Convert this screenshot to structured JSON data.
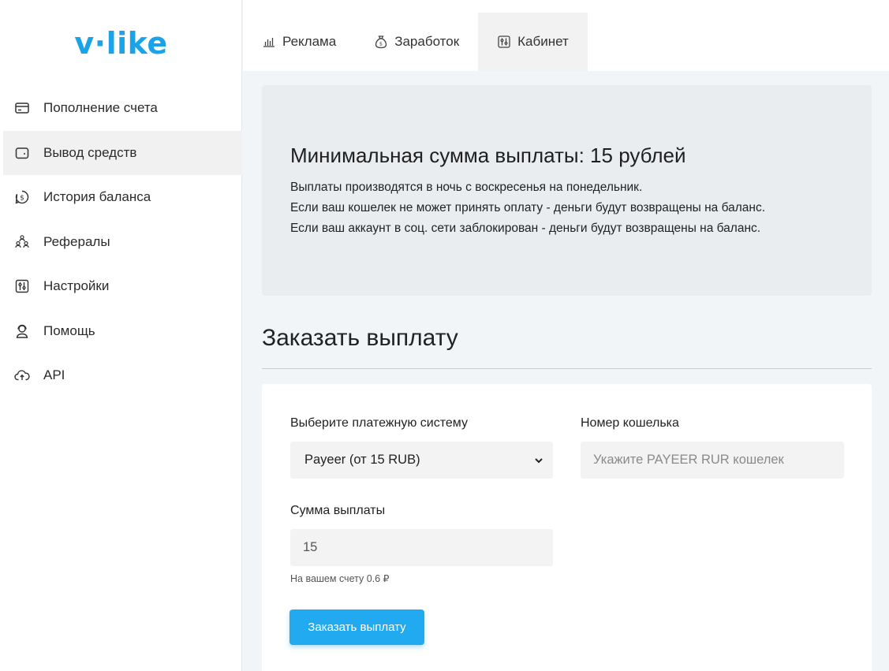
{
  "brand": {
    "logo_text": "v·like",
    "accent_color": "#1aa3e8"
  },
  "sidebar": {
    "items": [
      {
        "label": "Пополнение счета",
        "icon": "credit-card-icon",
        "active": false
      },
      {
        "label": "Вывод средств",
        "icon": "wallet-icon",
        "active": true
      },
      {
        "label": "История баланса",
        "icon": "dollar-coin-icon",
        "active": false
      },
      {
        "label": "Рефералы",
        "icon": "people-group-icon",
        "active": false
      },
      {
        "label": "Настройки",
        "icon": "sliders-icon",
        "active": false
      },
      {
        "label": "Помощь",
        "icon": "support-agent-icon",
        "active": false
      },
      {
        "label": "API",
        "icon": "cloud-upload-icon",
        "active": false
      }
    ]
  },
  "tabs": [
    {
      "label": "Реклама",
      "icon": "bar-chart-icon",
      "active": false
    },
    {
      "label": "Заработок",
      "icon": "money-bag-icon",
      "active": false
    },
    {
      "label": "Кабинет",
      "icon": "sliders-icon",
      "active": true
    }
  ],
  "info": {
    "title": "Минимальная сумма выплаты: 15 рублей",
    "lines": [
      "Выплаты производятся в ночь с воскресенья на понедельник.",
      "Если ваш кошелек не может принять оплату - деньги будут возвращены на баланс.",
      "Если ваш аккаунт в соц. сети заблокирован - деньги будут возвращены на баланс."
    ]
  },
  "payout": {
    "section_title": "Заказать выплату",
    "payment_system_label": "Выберите платежную систему",
    "payment_system_value": "Payeer (от 15 RUB)",
    "wallet_label": "Номер кошелька",
    "wallet_placeholder": "Укажите PAYEER RUR кошелек",
    "amount_label": "Сумма выплаты",
    "amount_value": "15",
    "balance_hint": "На вашем счету 0.6 ₽",
    "submit_label": "Заказать выплату",
    "button_color": "#22aaf0"
  }
}
